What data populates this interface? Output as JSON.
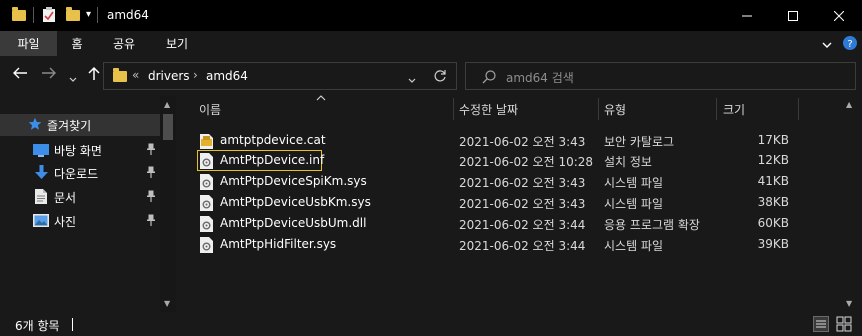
{
  "window": {
    "title": "amd64",
    "qat_dropdown": "▾"
  },
  "ribbon": {
    "tabs": [
      {
        "label": "파일"
      },
      {
        "label": "홈"
      },
      {
        "label": "공유"
      },
      {
        "label": "보기"
      }
    ]
  },
  "address": {
    "overflow": "«",
    "crumbs": [
      "drivers",
      "amd64"
    ]
  },
  "search": {
    "placeholder": "amd64 검색"
  },
  "sidebar": {
    "items": [
      {
        "label": "즐겨찾기",
        "icon": "star-icon"
      },
      {
        "label": "바탕 화면",
        "icon": "desktop-icon"
      },
      {
        "label": "다운로드",
        "icon": "download-icon"
      },
      {
        "label": "문서",
        "icon": "document-icon"
      },
      {
        "label": "사진",
        "icon": "pictures-icon"
      }
    ]
  },
  "columns": {
    "name": "이름",
    "date": "수정한 날짜",
    "type": "유형",
    "size": "크기"
  },
  "files": [
    {
      "name": "amtptpdevice.cat",
      "date": "2021-06-02 오전 3:43",
      "type": "보안 카탈로그",
      "size": "17KB",
      "icon": "catalog-file-icon"
    },
    {
      "name": "AmtPtpDevice.inf",
      "date": "2021-06-02 오전 10:28",
      "type": "설치 정보",
      "size": "12KB",
      "icon": "setup-info-file-icon"
    },
    {
      "name": "AmtPtpDeviceSpiKm.sys",
      "date": "2021-06-02 오전 3:43",
      "type": "시스템 파일",
      "size": "41KB",
      "icon": "system-file-icon"
    },
    {
      "name": "AmtPtpDeviceUsbKm.sys",
      "date": "2021-06-02 오전 3:43",
      "type": "시스템 파일",
      "size": "38KB",
      "icon": "system-file-icon"
    },
    {
      "name": "AmtPtpDeviceUsbUm.dll",
      "date": "2021-06-02 오전 3:44",
      "type": "응용 프로그램 확장",
      "size": "60KB",
      "icon": "dll-file-icon"
    },
    {
      "name": "AmtPtpHidFilter.sys",
      "date": "2021-06-02 오전 3:44",
      "type": "시스템 파일",
      "size": "39KB",
      "icon": "system-file-icon"
    }
  ],
  "status": {
    "count": "6개 항목"
  },
  "colors": {
    "background": "#191919",
    "titlebar": "#000000",
    "folder": "#e8c14a",
    "focus_border": "#e6c229",
    "selected_sidebar": "#333333"
  }
}
